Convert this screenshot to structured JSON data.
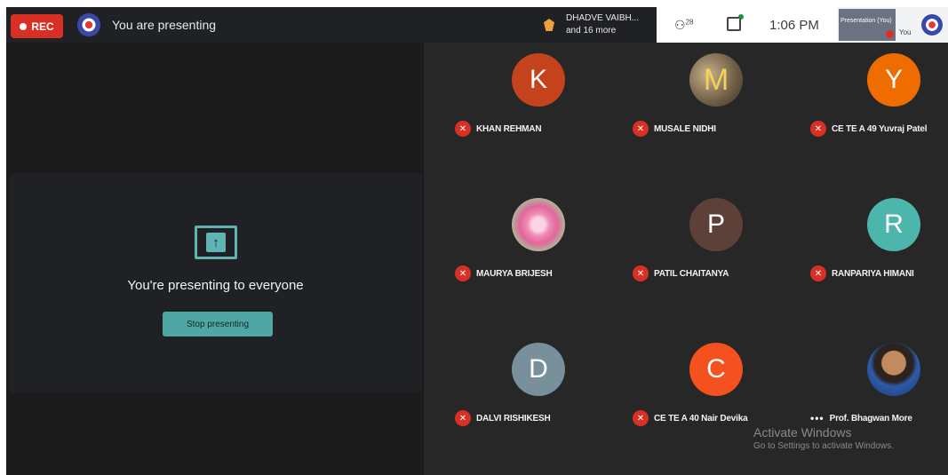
{
  "topbar": {
    "rec_label": "REC",
    "title": "You are presenting",
    "speaker_line1": "DHADVE VAIBH...",
    "speaker_line2": "and 16 more",
    "people_count": "28",
    "time": "1:06 PM",
    "presentation_label": "Presentation (You)",
    "you_label": "You"
  },
  "presenting": {
    "message": "You're presenting to everyone",
    "stop_button": "Stop presenting"
  },
  "participants": [
    {
      "name": "KHAN REHMAN",
      "initial": "K",
      "color": "#c5431c",
      "muted": true
    },
    {
      "name": "MUSALE NIDHI",
      "initial": "M",
      "color": "photo-m",
      "muted": true
    },
    {
      "name": "CE TE A 49 Yuvraj Patel",
      "initial": "Y",
      "color": "#ef6c00",
      "muted": true
    },
    {
      "name": "MAURYA BRIJESH",
      "initial": "",
      "color": "photo-flower",
      "muted": true
    },
    {
      "name": "PATIL CHAITANYA",
      "initial": "P",
      "color": "#5d4037",
      "muted": true
    },
    {
      "name": "RANPARIYA HIMANI",
      "initial": "R",
      "color": "#4db6ac",
      "muted": true
    },
    {
      "name": "DALVI RISHIKESH",
      "initial": "D",
      "color": "#78909c",
      "muted": true
    },
    {
      "name": "CE TE A 40 Nair Devika",
      "initial": "C",
      "color": "#f4511e",
      "muted": true
    },
    {
      "name": "Prof. Bhagwan More",
      "initial": "",
      "color": "photo-person",
      "muted": false
    }
  ],
  "watermark": {
    "line1": "Activate Windows",
    "line2": "Go to Settings to activate Windows."
  }
}
